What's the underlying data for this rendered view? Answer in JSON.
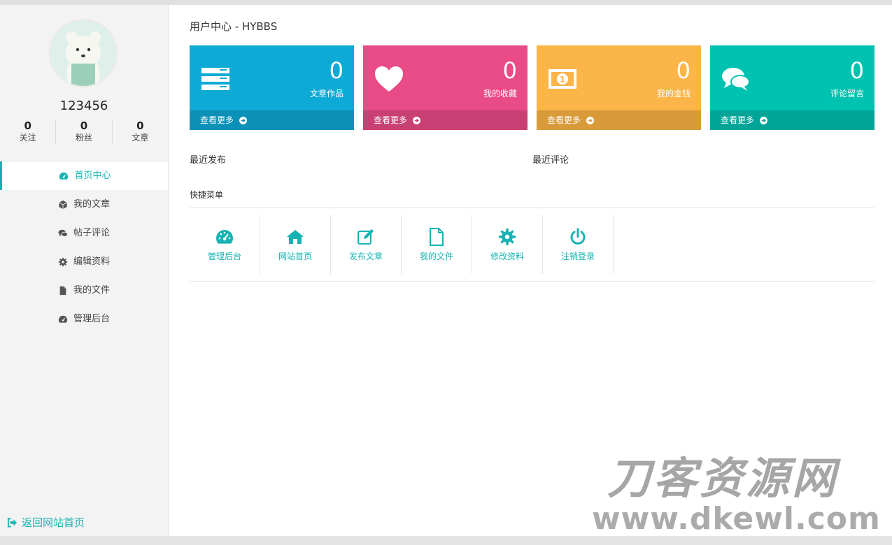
{
  "page_title": "用户中心 - HYBBS",
  "user": {
    "name": "123456",
    "stats": [
      {
        "num": "0",
        "label": "关注"
      },
      {
        "num": "0",
        "label": "粉丝"
      },
      {
        "num": "0",
        "label": "文章"
      }
    ]
  },
  "sidebar": {
    "items": [
      {
        "label": "首页中心",
        "icon": "dashboard-icon",
        "active": true
      },
      {
        "label": "我的文章",
        "icon": "cube-icon"
      },
      {
        "label": "帖子评论",
        "icon": "comments-icon"
      },
      {
        "label": "编辑资料",
        "icon": "gear-icon"
      },
      {
        "label": "我的文件",
        "icon": "file-icon"
      },
      {
        "label": "管理后台",
        "icon": "dashboard-icon"
      }
    ],
    "back_label": "返回网站首页"
  },
  "cards": [
    {
      "value": "0",
      "label": "文章作品",
      "more": "查看更多",
      "color": "#0eaad6",
      "footer_color": "#0b91b8",
      "icon": "server-icon"
    },
    {
      "value": "0",
      "label": "我的收藏",
      "more": "查看更多",
      "color": "#e94b86",
      "footer_color": "#c94074",
      "icon": "heart-icon"
    },
    {
      "value": "0",
      "label": "我的金钱",
      "more": "查看更多",
      "color": "#fbb548",
      "footer_color": "#d99b3a",
      "icon": "money-icon"
    },
    {
      "value": "0",
      "label": "评论留言",
      "more": "查看更多",
      "color": "#00c2b0",
      "footer_color": "#00a597",
      "icon": "comments-icon"
    }
  ],
  "sections": {
    "recent_posts": "最近发布",
    "recent_comments": "最近评论",
    "quick_menu": "快捷菜单"
  },
  "quick_menu": [
    {
      "label": "管理后台",
      "icon": "dashboard-icon"
    },
    {
      "label": "网站首页",
      "icon": "home-icon"
    },
    {
      "label": "发布文章",
      "icon": "edit-icon"
    },
    {
      "label": "我的文件",
      "icon": "file-icon"
    },
    {
      "label": "修改资料",
      "icon": "gear-icon"
    },
    {
      "label": "注销登录",
      "icon": "power-icon"
    }
  ],
  "watermark": {
    "cn": "刀客资源网",
    "url": "www.dkewl.com"
  }
}
